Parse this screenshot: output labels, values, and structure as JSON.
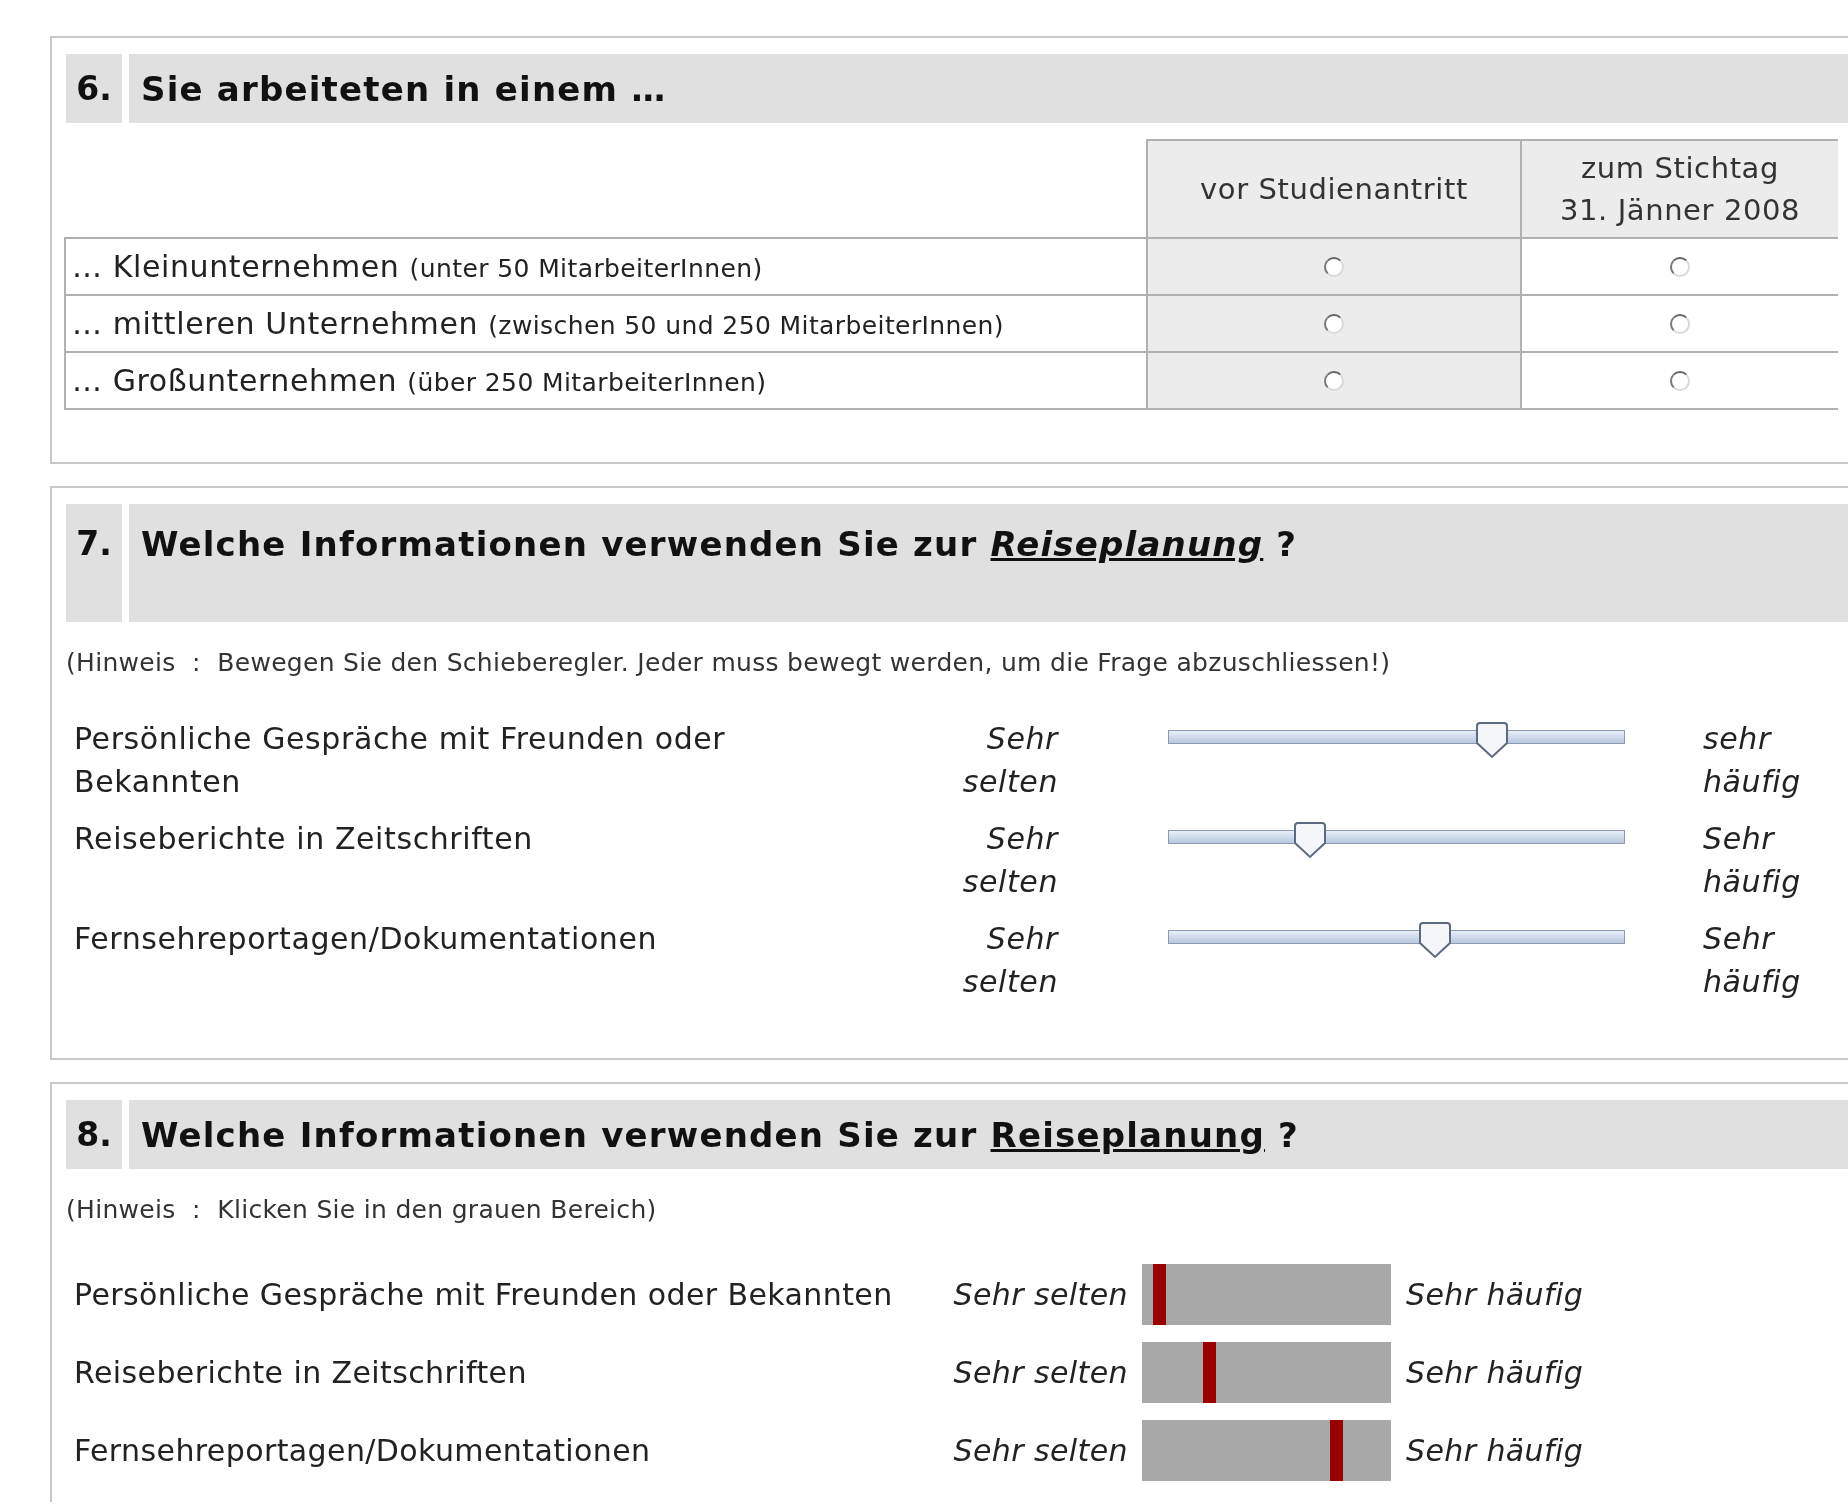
{
  "sections": [
    {
      "kind": "table",
      "number": "6.",
      "title_before": "Sie arbeiteten in einem …",
      "columns": [
        "vor Studienantritt",
        "zum Stichtag\n31. Jänner 2008"
      ],
      "rows": [
        {
          "label": "… Kleinunternehmen",
          "note": "(unter 50 MitarbeiterInnen)",
          "options": [
            {
              "checked": false
            },
            {
              "checked": false
            }
          ]
        },
        {
          "label": "… mittleren Unternehmen",
          "note": "(zwischen 50 und 250 MitarbeiterInnen)",
          "options": [
            {
              "checked": false
            },
            {
              "checked": false
            }
          ]
        },
        {
          "label": "… Großunternehmen",
          "note": "(über 250 MitarbeiterInnen)",
          "options": [
            {
              "checked": false
            },
            {
              "checked": false
            }
          ]
        }
      ]
    },
    {
      "kind": "slider",
      "number": "7.",
      "title_before": "Welche Informationen verwenden Sie zur",
      "keyword": "Reiseplanung",
      "keyword_italic": true,
      "title_after": "?",
      "hint": "(Hinweis  :  Bewegen Sie den Schieberegler. Jeder muss bewegt werden, um die Frage abzuschliessen!)",
      "items": [
        {
          "label": "Persönliche Gespräche mit Freunden oder Bekannten",
          "low": "Sehr selten",
          "high": "sehr häufig",
          "level": 0.71
        },
        {
          "label": "Reiseberichte in Zeitschriften",
          "low": "Sehr selten",
          "high": "Sehr häufig",
          "level": 0.31
        },
        {
          "label": "Fernsehreportagen/Dokumentationen",
          "low": "Sehr selten",
          "high": "Sehr häufig",
          "level": 0.585
        }
      ]
    },
    {
      "kind": "clickbar",
      "number": "8.",
      "title_before": "Welche Informationen verwenden Sie zur",
      "keyword": "Reiseplanung",
      "keyword_italic": false,
      "title_after": "?",
      "hint": "(Hinweis  :  Klicken Sie in den grauen Bereich)",
      "items": [
        {
          "label": "Persönliche Gespräche mit Freunden oder Bekannten",
          "low": "Sehr selten",
          "high": "Sehr häufig",
          "level": 0.07
        },
        {
          "label": "Reiseberichte in Zeitschriften",
          "low": "Sehr selten",
          "high": "Sehr häufig",
          "level": 0.27
        },
        {
          "label": "Fernsehreportagen/Dokumentationen",
          "low": "Sehr selten",
          "high": "Sehr häufig",
          "level": 0.78
        }
      ]
    }
  ]
}
